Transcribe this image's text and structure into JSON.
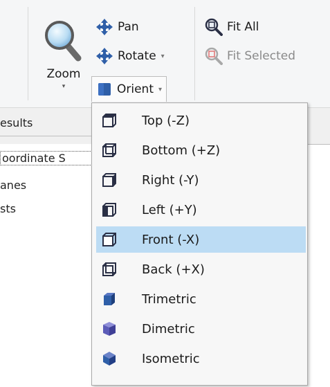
{
  "ribbon": {
    "zoom": {
      "label": "Zoom",
      "caret": "▾",
      "icon": "magnifier-icon"
    },
    "pan": {
      "label": "Pan",
      "icon": "pan-arrows-icon"
    },
    "rotate": {
      "label": "Rotate",
      "caret": "▾",
      "icon": "rotate-arrows-icon"
    },
    "orient": {
      "label": "Orient",
      "caret": "▾",
      "icon": "cube-icon"
    },
    "fit_all": {
      "label": "Fit All",
      "icon": "zoom-fit-icon"
    },
    "fit_selected": {
      "label": "Fit Selected",
      "icon": "zoom-fit-selected-icon",
      "disabled": true
    }
  },
  "results_tab": {
    "label": "esults"
  },
  "tree": {
    "items": [
      {
        "label": "oordinate S"
      },
      {
        "label": "anes"
      },
      {
        "label": "sts"
      }
    ]
  },
  "orient_menu": {
    "hovered_index": 4,
    "items": [
      {
        "label": "Top (-Z)",
        "icon": "cube-top-icon"
      },
      {
        "label": "Bottom (+Z)",
        "icon": "cube-bottom-icon"
      },
      {
        "label": "Right (-Y)",
        "icon": "cube-right-icon"
      },
      {
        "label": "Left (+Y)",
        "icon": "cube-left-icon"
      },
      {
        "label": "Front (-X)",
        "icon": "cube-front-icon"
      },
      {
        "label": "Back (+X)",
        "icon": "cube-back-icon"
      },
      {
        "label": "Trimetric",
        "icon": "cube-trimetric-icon"
      },
      {
        "label": "Dimetric",
        "icon": "cube-dimetric-icon"
      },
      {
        "label": "Isometric",
        "icon": "cube-isometric-icon"
      }
    ]
  },
  "colors": {
    "ribbon_bg": "#f5f6f7",
    "menu_bg": "#f7f7f7",
    "hover_bg": "#bcdcf4",
    "icon_blue": "#2f5fa8",
    "icon_dark": "#2a2f45"
  }
}
